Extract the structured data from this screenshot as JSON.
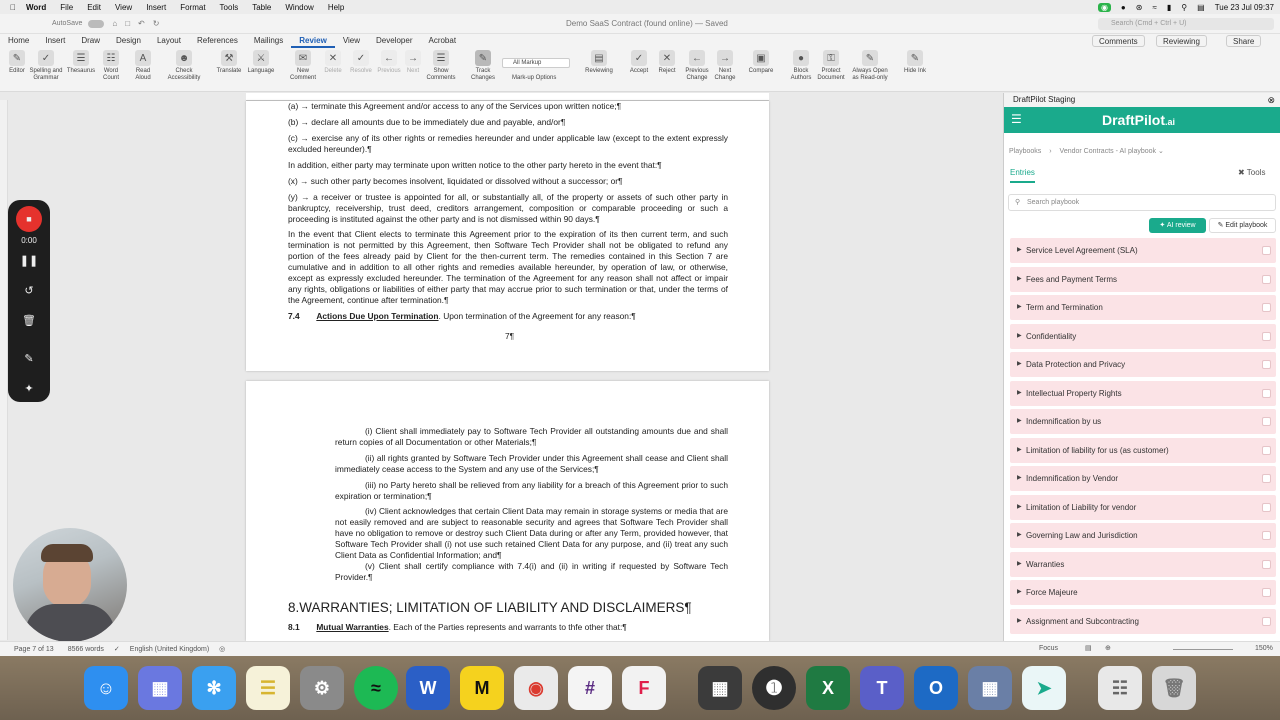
{
  "menubar": {
    "app": "Word",
    "items": [
      "File",
      "Edit",
      "View",
      "Insert",
      "Format",
      "Tools",
      "Table",
      "Window",
      "Help"
    ],
    "datetime": "Tue 23 Jul 09:37"
  },
  "titlebar": {
    "autosave": "AutoSave",
    "doc_title": "Demo SaaS Contract (found online) — Saved",
    "search_placeholder": "Search (Cmd + Ctrl + U)"
  },
  "tabs": [
    "Home",
    "Insert",
    "Draw",
    "Design",
    "Layout",
    "References",
    "Mailings",
    "Review",
    "View",
    "Developer",
    "Acrobat"
  ],
  "tab_right": {
    "comments": "Comments",
    "reviewing": "Reviewing",
    "share": "Share"
  },
  "ribbon": {
    "buttons": [
      "Editor",
      "Spelling and Grammar",
      "Thesaurus",
      "Word Count",
      "Read Aloud",
      "Check Accessibility",
      "Translate",
      "Language",
      "New Comment",
      "Delete",
      "Resolve",
      "Previous",
      "Next",
      "Show Comments",
      "Track Changes",
      "Reviewing",
      "Accept",
      "Reject",
      "Previous Change",
      "Next Change",
      "Compare",
      "Block Authors",
      "Protect Document",
      "Always Open as Read-only",
      "Hide Ink"
    ],
    "markup_select": "All Markup",
    "markup_options": "Mark-up Options"
  },
  "page1": {
    "l1": "(a) → terminate this Agreement and/or access to any of the Services upon written notice;¶",
    "l2": "(b) → declare all amounts due to be immediately due and payable, and/or¶",
    "l3": "(c) → exercise any of its other rights or remedies hereunder and under applicable law (except to the extent expressly excluded hereunder).¶",
    "l4": "In addition, either party may terminate upon written notice to the other party hereto in the event that:¶",
    "l5": "(x) → such other party becomes insolvent, liquidated or dissolved without a successor; or¶",
    "l6": "(y) → a receiver or trustee is appointed for all, or substantially all, of the property or assets of such other party in bankruptcy, receivership, trust deed, creditors arrangement, composition or comparable proceeding or such a proceeding is instituted against the other party and is not dismissed within 90 days.¶",
    "l7": "In the event that Client elects to terminate this Agreement prior to the expiration of its then current term, and such termination is not permitted by this Agreement, then Software Tech Provider shall not be obligated to refund any portion of the fees already paid by Client for the then-current term. The remedies contained in this Section 7 are cumulative and in addition to all other rights and remedies available hereunder, by operation of law, or otherwise, except as expressly excluded hereunder. The termination of the Agreement for any reason shall not affect or impair any rights, obligations or liabilities of either party that may accrue prior to such termination or that, under the terms of the Agreement, continue after termination.¶",
    "s74_num": "7.4",
    "s74_title": "Actions Due Upon Termination",
    "s74_text": "Upon termination of the Agreement for any reason:¶",
    "page_no": "7¶"
  },
  "page2": {
    "i1": "(i) Client shall immediately pay to Software Tech Provider all outstanding amounts due and shall return copies of all Documentation or other Materials;¶",
    "i2": "(ii) all rights granted by Software Tech Provider under this Agreement shall cease and Client shall immediately cease access to the System and any use of the Services;¶",
    "i3": "(iii) no Party hereto shall be relieved from any liability for a breach of this Agreement prior to such expiration or termination;¶",
    "i4": "(iv) Client acknowledges that certain Client Data may remain in storage systems or media that are not easily removed and are subject to reasonable security and agrees that Software Tech Provider shall have no obligation to remove or destroy such Client Data during or after any Term, provided however, that Software Tech Provider shall (i) not use such retained Client Data for any purpose, and (ii) treat any such Client Data as Confidential Information; and¶",
    "i5": "(v) Client shall certify compliance with 7.4(i) and (ii) in writing if requested by Software Tech Provider.¶",
    "h8": "8.WARRANTIES; LIMITATION OF LIABILITY AND DISCLAIMERS¶",
    "s81_num": "8.1",
    "s81_title": "Mutual Warranties",
    "s81_text": "Each of the Parties represents and warrants to thfe other that:¶"
  },
  "recorder": {
    "time": "0:00"
  },
  "status": {
    "page": "Page 7 of 13",
    "words": "8566 words",
    "language": "English (United Kingdom)",
    "focus": "Focus",
    "zoom": "150%"
  },
  "panel": {
    "header": "DraftPilot Staging",
    "brand": "DraftPilot",
    "brand_suffix": ".ai",
    "crumb1": "Playbooks",
    "crumb2": "Vendor Contracts - AI playbook",
    "tab_entries": "Entries",
    "tools": "Tools",
    "search_placeholder": "Search playbook",
    "ai_review": "AI review",
    "edit_playbook": "Edit playbook",
    "entries": [
      "Service Level Agreement (SLA)",
      "Fees and Payment Terms",
      "Term and Termination",
      "Confidentiality",
      "Data Protection and Privacy",
      "Intellectual Property Rights",
      "Indemnification by us",
      "Limitation of liability for us (as customer)",
      "Indemnification by Vendor",
      "Limitation of Liability for vendor",
      "Governing Law and Jurisdiction",
      "Warranties",
      "Force Majeure",
      "Assignment and Subcontracting"
    ]
  },
  "colors": {
    "accent": "#1aaa8c",
    "entry_bg": "#fbe3e6",
    "word_blue": "#1f5fb5"
  }
}
